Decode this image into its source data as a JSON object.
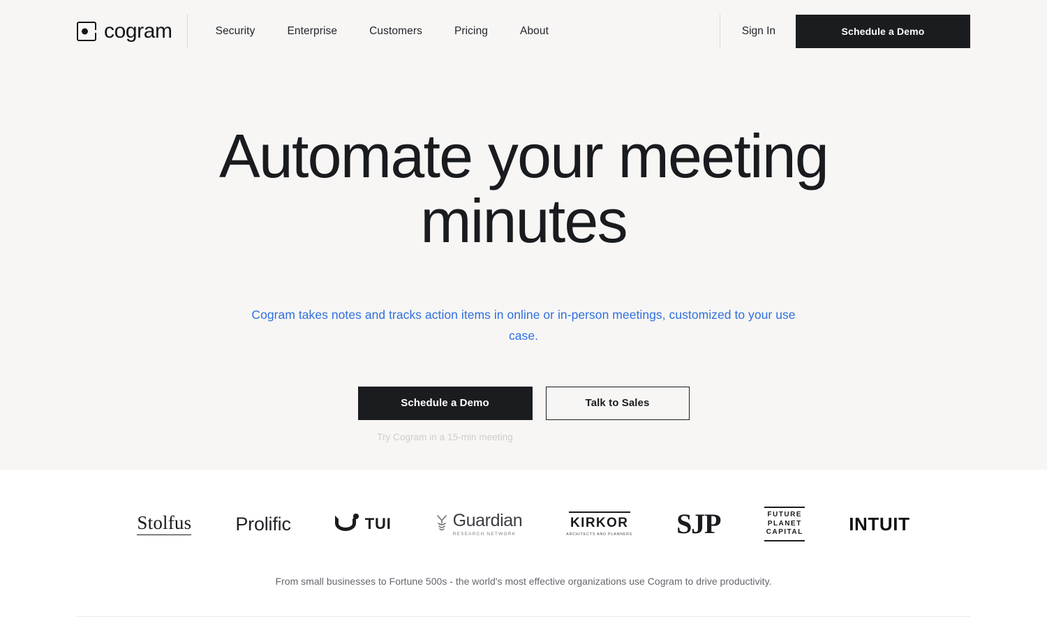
{
  "brand": {
    "name": "cogram",
    "mark": "square-dot-logo"
  },
  "nav": {
    "items": [
      {
        "label": "Security"
      },
      {
        "label": "Enterprise"
      },
      {
        "label": "Customers"
      },
      {
        "label": "Pricing"
      },
      {
        "label": "About"
      }
    ],
    "sign_in": "Sign In",
    "demo_button": "Schedule a Demo"
  },
  "hero": {
    "title": "Automate your meeting minutes",
    "subtitle": "Cogram takes notes and tracks action items in online or in-person meetings, customized to your use case.",
    "primary_cta": "Schedule a Demo",
    "secondary_cta": "Talk to Sales",
    "cta_note": "Try Cogram in a 15-min meeting"
  },
  "logos": {
    "items": [
      {
        "name": "Stolfus",
        "style": "serif-underlined"
      },
      {
        "name": "Prolific",
        "style": "sans"
      },
      {
        "name": "TUI",
        "style": "smile-mark"
      },
      {
        "name": "Guardian",
        "tagline": "RESEARCH NETWORK",
        "style": "dna-mark"
      },
      {
        "name": "KIRKOR",
        "tagline": "ARCHITECTS AND PLANNERS",
        "style": "ruled"
      },
      {
        "name": "SJP",
        "style": "serif-bold"
      },
      {
        "name": "FUTURE PLANET CAPITAL",
        "line1": "FUTURE",
        "line2": "PLANET",
        "line3": "CAPITAL",
        "style": "ruled-stack"
      },
      {
        "name": "INTUIT",
        "style": "sans-bold"
      }
    ],
    "caption": "From small businesses to Fortune 500s - the world's most effective organizations use Cogram to drive productivity."
  },
  "colors": {
    "hero_background": "#f7f6f4",
    "page_background": "#ffffff",
    "ink": "#1a1b1f",
    "button_dark": "#1b1c1f",
    "accent_blue": "#2f6fe0",
    "muted_note": "#cfccc8",
    "caption_gray": "#64666c"
  }
}
